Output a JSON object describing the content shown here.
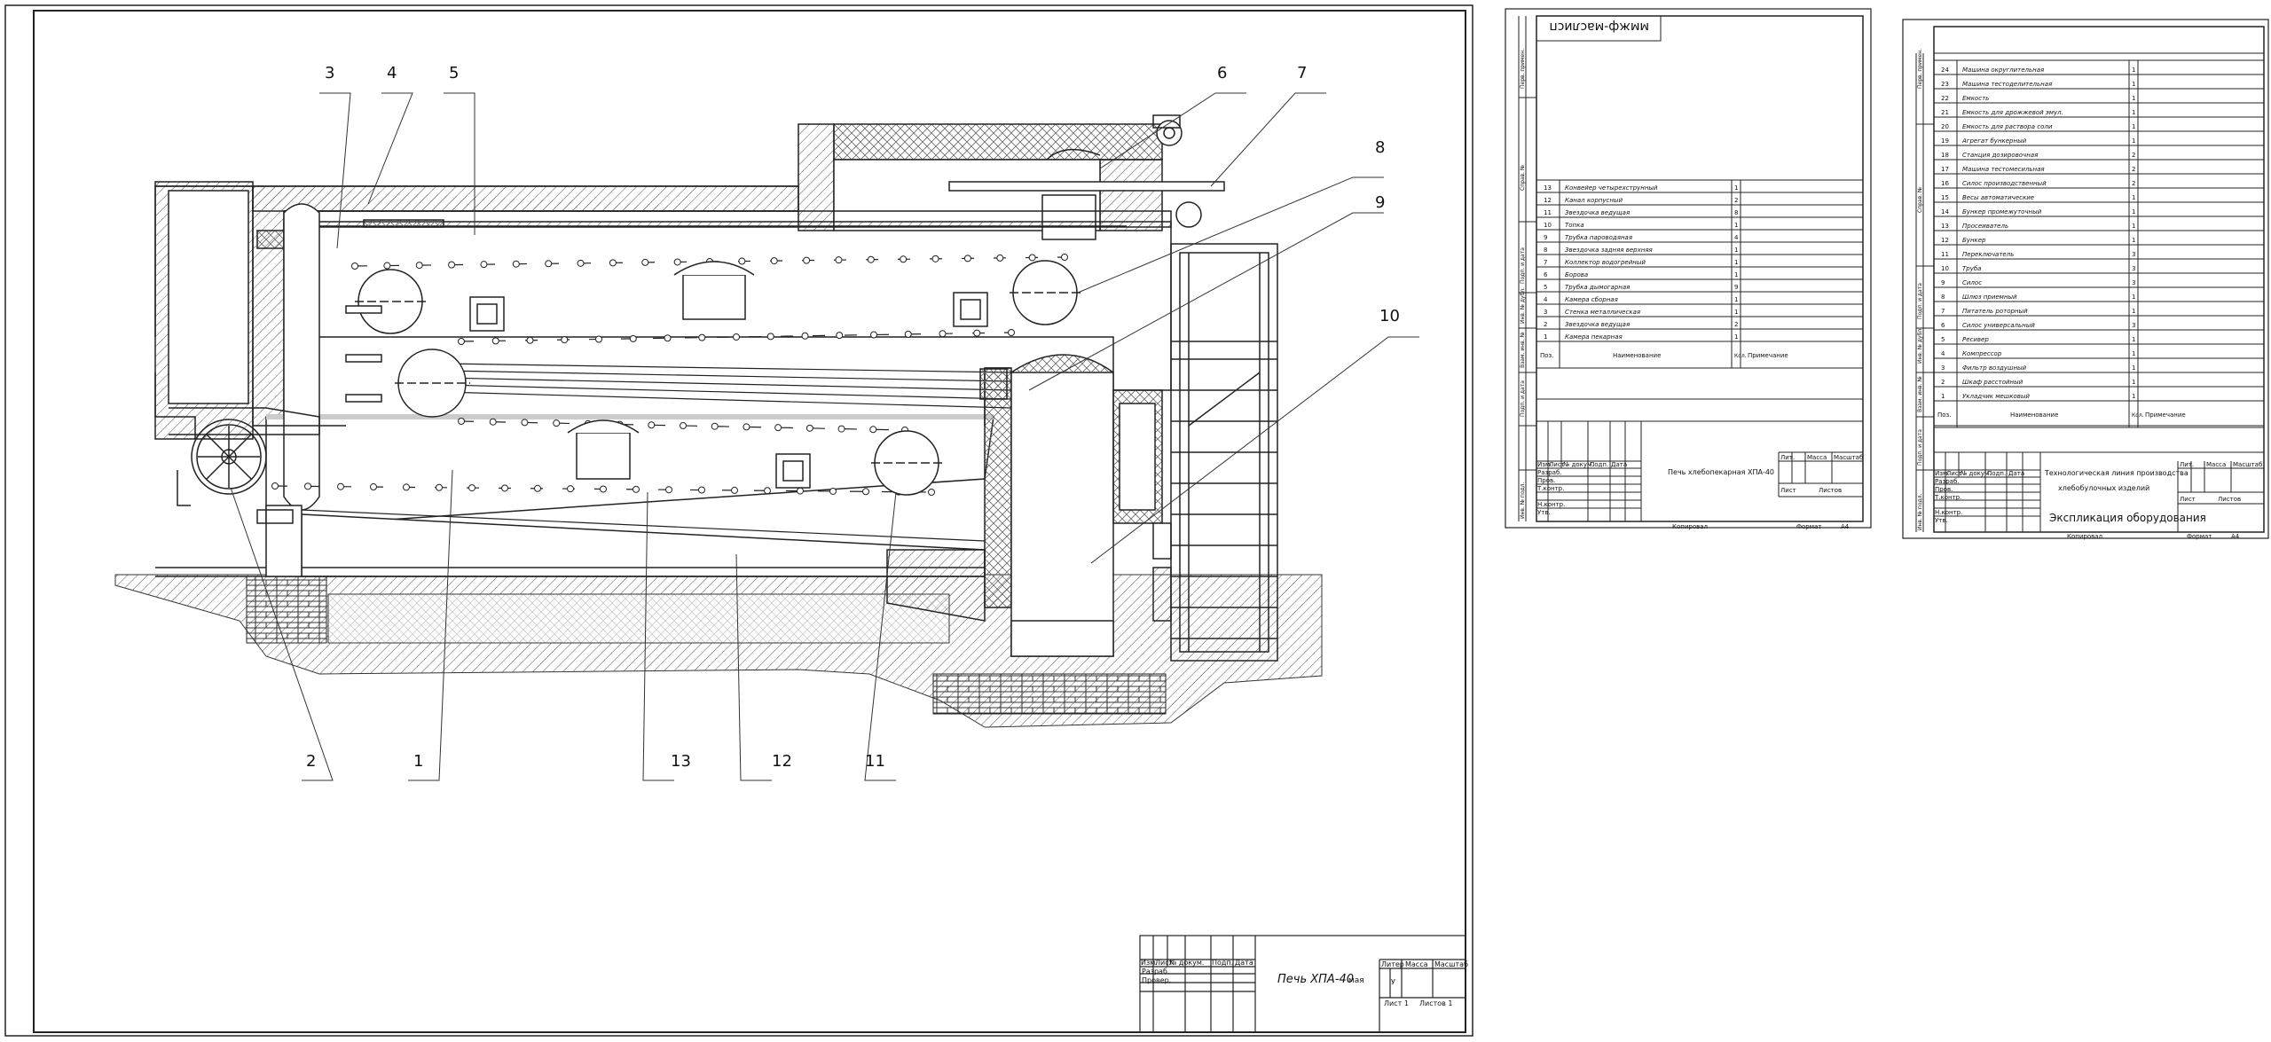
{
  "main_sheet": {
    "callouts": [
      "1",
      "2",
      "3",
      "4",
      "5",
      "6",
      "7",
      "8",
      "9",
      "10",
      "11",
      "12",
      "13"
    ],
    "title_block": {
      "title": "Печь ХПА-40",
      "title_suffix": "мая",
      "headers": [
        "Изм.",
        "Лист",
        "№ докум.",
        "Подп.",
        "Дата"
      ],
      "roles": [
        "Разраб.",
        "Провер."
      ],
      "lit_headers": [
        "Литер",
        "Масса",
        "Масштаб"
      ],
      "lit_value": "У",
      "sheet": "Лист 1",
      "sheets": "Листов 1"
    }
  },
  "spec_sheet_1": {
    "stamp": "ммжф-маслисп",
    "side_labels": [
      "Перв. примен.",
      "Справ. №",
      "Подп. и дата",
      "Инв. № дубл.",
      "Взам. инв. №",
      "Подп. и дата",
      "Инв. № подл."
    ],
    "rows": [
      {
        "pos": "13",
        "name": "Конвейер четырехструнный",
        "qty": "1"
      },
      {
        "pos": "12",
        "name": "Канал корпусный",
        "qty": "2"
      },
      {
        "pos": "11",
        "name": "Звездочка ведущая",
        "qty": "8"
      },
      {
        "pos": "10",
        "name": "Топка",
        "qty": "1"
      },
      {
        "pos": "9",
        "name": "Трубка пароводяная",
        "qty": "4"
      },
      {
        "pos": "8",
        "name": "Звездочка задняя верхняя",
        "qty": "1"
      },
      {
        "pos": "7",
        "name": "Коллектор водогрейный",
        "qty": "1"
      },
      {
        "pos": "6",
        "name": "Борова",
        "qty": "1"
      },
      {
        "pos": "5",
        "name": "Трубка дымогарная",
        "qty": "9"
      },
      {
        "pos": "4",
        "name": "Камера сборная",
        "qty": "1"
      },
      {
        "pos": "3",
        "name": "Стенка металлическая",
        "qty": "1"
      },
      {
        "pos": "2",
        "name": "Звездочка ведущая",
        "qty": "2"
      },
      {
        "pos": "1",
        "name": "Камера пекарная",
        "qty": "1"
      }
    ],
    "header": {
      "pos": "Поз.",
      "name": "Наименование",
      "qty": "Кол.",
      "note": "Примечание"
    },
    "title": "Печь хлебопекарная ХПА-40",
    "block_headers": [
      "Изм.",
      "Лист",
      "№ докум.",
      "Подп.",
      "Дата"
    ],
    "roles": [
      "Разраб.",
      "Пров.",
      "Т.контр.",
      "Н.контр.",
      "Утв."
    ],
    "lit_headers": [
      "Лит.",
      "Масса",
      "Масштаб"
    ],
    "sheet": "Лист",
    "sheets": "Листов",
    "copied": "Копировал",
    "format": "Формат",
    "format_value": "А4"
  },
  "spec_sheet_2": {
    "side_labels": [
      "Перв. примен.",
      "Справ. №",
      "Подп. и дата",
      "Инв. № дубл.",
      "Взам. инв. №",
      "Подп. и дата",
      "Инв. № подл."
    ],
    "rows": [
      {
        "pos": "24",
        "name": "Машина округлительная",
        "qty": "1"
      },
      {
        "pos": "23",
        "name": "Машина тестоделительная",
        "qty": "1"
      },
      {
        "pos": "22",
        "name": "Емкость",
        "qty": "1"
      },
      {
        "pos": "21",
        "name": "Емкость для дрожжевой эмул.",
        "qty": "1"
      },
      {
        "pos": "20",
        "name": "Емкость для раствора соли",
        "qty": "1"
      },
      {
        "pos": "19",
        "name": "Агрегат бункерный",
        "qty": "1"
      },
      {
        "pos": "18",
        "name": "Станция дозировочная",
        "qty": "2"
      },
      {
        "pos": "17",
        "name": "Машина тестомесильная",
        "qty": "2"
      },
      {
        "pos": "16",
        "name": "Силос производственный",
        "qty": "2"
      },
      {
        "pos": "15",
        "name": "Весы автоматические",
        "qty": "1"
      },
      {
        "pos": "14",
        "name": "Бункер промежуточный",
        "qty": "1"
      },
      {
        "pos": "13",
        "name": "Просеиватель",
        "qty": "1"
      },
      {
        "pos": "12",
        "name": "Бункер",
        "qty": "1"
      },
      {
        "pos": "11",
        "name": "Переключатель",
        "qty": "3"
      },
      {
        "pos": "10",
        "name": "Труба",
        "qty": "3"
      },
      {
        "pos": "9",
        "name": "Силос",
        "qty": "3"
      },
      {
        "pos": "8",
        "name": "Шлюз приемный",
        "qty": "1"
      },
      {
        "pos": "7",
        "name": "Питатель роторный",
        "qty": "1"
      },
      {
        "pos": "6",
        "name": "Силос универсальный",
        "qty": "3"
      },
      {
        "pos": "5",
        "name": "Ресивер",
        "qty": "1"
      },
      {
        "pos": "4",
        "name": "Компрессор",
        "qty": "1"
      },
      {
        "pos": "3",
        "name": "Фильтр воздушный",
        "qty": "1"
      },
      {
        "pos": "2",
        "name": "Шкаф расстойный",
        "qty": "1"
      },
      {
        "pos": "1",
        "name": "Укладчик мешковый",
        "qty": "1"
      }
    ],
    "header": {
      "pos": "Поз.",
      "name": "Наименование",
      "qty": "Кол.",
      "note": "Примечание"
    },
    "title_line1": "Технологическая линия производства",
    "title_line2": "хлебобулочных изделий",
    "subtitle": "Экспликация оборудования",
    "block_headers": [
      "Изм.",
      "Лист",
      "№ докум.",
      "Подп.",
      "Дата"
    ],
    "roles": [
      "Разраб.",
      "Пров.",
      "Т.контр.",
      "Н.контр.",
      "Утв."
    ],
    "lit_headers": [
      "Лит.",
      "Масса",
      "Масштаб"
    ],
    "sheet": "Лист",
    "sheets": "Листов",
    "copied": "Копировал",
    "format": "Формат",
    "format_value": "А4"
  }
}
